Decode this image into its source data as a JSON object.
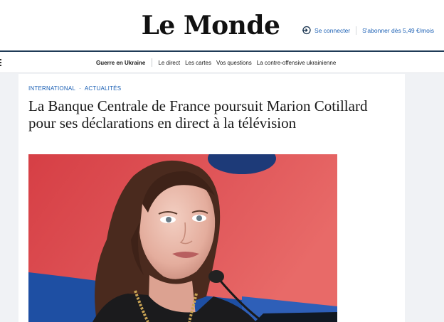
{
  "header": {
    "logo_text": "Le Monde",
    "login_label": "Se connecter",
    "subscribe_label": "S'abonner dès 5,49 €/mois"
  },
  "nav": {
    "items": [
      {
        "label": "Guerre en Ukraine"
      },
      {
        "label": "Le direct"
      },
      {
        "label": "Les cartes"
      },
      {
        "label": "Vos questions"
      },
      {
        "label": "La contre-offensive ukrainienne"
      }
    ]
  },
  "article": {
    "kicker": [
      "INTERNATIONAL",
      "ACTUALITÉS"
    ],
    "kicker_separator": "·",
    "headline": "La Banque Centrale de France poursuit Marion Cotillard pour ses déclarations en direct à la télévision"
  },
  "colors": {
    "link_blue": "#1a5fb4",
    "header_rule": "#1f3b57",
    "photo_background": "#d94b4e"
  },
  "icons": {
    "login": "login-arrow-icon",
    "nav_menu": "menu-dots-icon"
  }
}
